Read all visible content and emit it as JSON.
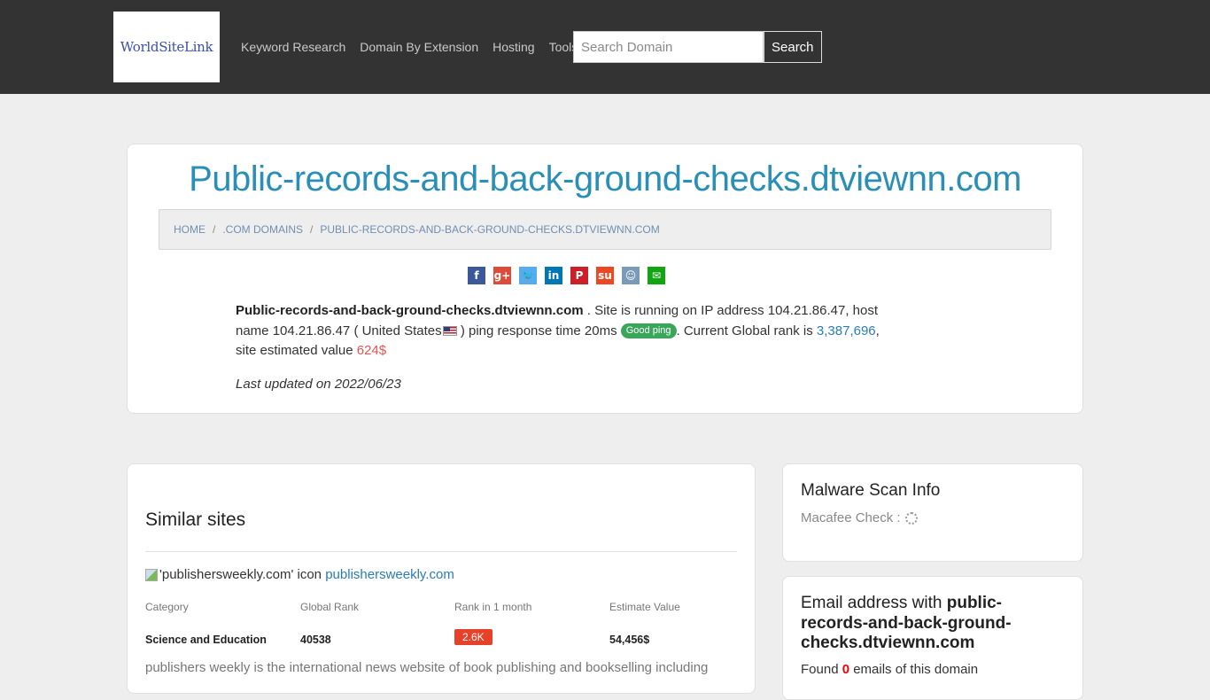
{
  "header": {
    "logo_text": "WorldSiteLink",
    "nav": [
      {
        "label": "Keyword Research"
      },
      {
        "label": "Domain By Extension"
      },
      {
        "label": "Hosting"
      },
      {
        "label": "Tools"
      }
    ],
    "search": {
      "placeholder": "Search Domain",
      "value": "",
      "button_label": "Search"
    }
  },
  "main": {
    "title": "Public-records-and-back-ground-checks.dtviewnn.com",
    "breadcrumb": [
      "HOME",
      ".COM DOMAINS",
      "PUBLIC-RECORDS-AND-BACK-GROUND-CHECKS.DTVIEWNN.COM"
    ],
    "share_icons": [
      {
        "name": "facebook-icon",
        "glyph": "f",
        "color": "#3b5998"
      },
      {
        "name": "google-plus-icon",
        "glyph": "g+",
        "color": "#dd4b39"
      },
      {
        "name": "twitter-icon",
        "glyph": "🐦",
        "color": "#55acee"
      },
      {
        "name": "linkedin-icon",
        "glyph": "in",
        "color": "#0077b5"
      },
      {
        "name": "pinterest-icon",
        "glyph": "P",
        "color": "#cb2027"
      },
      {
        "name": "stumbleupon-icon",
        "glyph": "su",
        "color": "#eb4924"
      },
      {
        "name": "reddit-icon",
        "glyph": "☺",
        "color": "#7a9ab8"
      },
      {
        "name": "email-icon",
        "glyph": "✉",
        "color": "#11a511"
      }
    ],
    "description": {
      "domain": "Public-records-and-back-ground-checks.dtviewnn.com",
      "text1": " . Site is running on IP address 104.21.86.47, host name 104.21.86.47 ( United States",
      "text2": " ) ping response time 20ms ",
      "ping_badge": "Good ping",
      "text3": ". Current Global rank is ",
      "global_rank": "3,387,696",
      "text4": ", site estimated value ",
      "value": "624$"
    },
    "last_updated": "Last updated on 2022/06/23"
  },
  "similar": {
    "title": "Similar sites",
    "sites": [
      {
        "icon_alt": "'publishersweekly.com' icon",
        "domain": "publishersweekly.com",
        "labels": [
          "Category",
          "Global Rank",
          "Rank in 1 month",
          "Estimate Value"
        ],
        "category": "Science and Education",
        "global_rank": "40538",
        "rank_1_month": "2.6K",
        "estimate_value": "54,456$",
        "description": "publishers weekly is the international news website of book publishing and bookselling including"
      }
    ]
  },
  "malware": {
    "title": "Malware Scan Info",
    "macafee_label": "Macafee Check :"
  },
  "email": {
    "title_prefix": "Email address with ",
    "title_domain": "public-records-and-back-ground-checks.dtviewnn.com",
    "found_prefix": "Found ",
    "found_count": "0",
    "found_suffix": " emails of this domain"
  }
}
